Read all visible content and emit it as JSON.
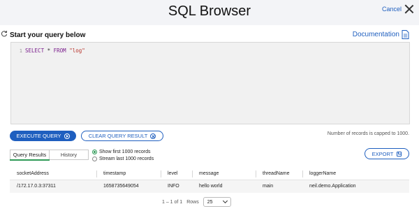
{
  "header": {
    "title": "SQL Browser",
    "cancel_label": "Cancel"
  },
  "query": {
    "prompt": "Start your query below",
    "documentation_label": "Documentation",
    "line_number": "1",
    "sql": {
      "select": "SELECT",
      "star": "*",
      "from": "FROM",
      "table": "\"log\""
    }
  },
  "actions": {
    "execute_label": "EXECUTE QUERY",
    "clear_label": "CLEAR QUERY RESULT",
    "cap_note": "Number of records is capped to 1000.",
    "export_label": "EXPORT"
  },
  "tabs": [
    {
      "label": "Query Results",
      "active": true
    },
    {
      "label": "History",
      "active": false
    }
  ],
  "record_options": [
    {
      "label": "Show first 1000 records",
      "selected": true
    },
    {
      "label": "Stream last 1000 records",
      "selected": false
    }
  ],
  "table": {
    "columns": [
      "socketAddress",
      "timestamp",
      "level",
      "message",
      "threadName",
      "loggerName"
    ],
    "rows": [
      [
        "/172.17.0.3:37311",
        "1658735649054",
        "INFO",
        "hello world",
        "main",
        "neil.demo.Application"
      ]
    ]
  },
  "pagination": {
    "range": "1 – 1 of 1",
    "rows_label": "Rows",
    "rows_value": "25"
  },
  "colors": {
    "accent": "#1f5fbf",
    "active_tab": "#2f9a57"
  }
}
